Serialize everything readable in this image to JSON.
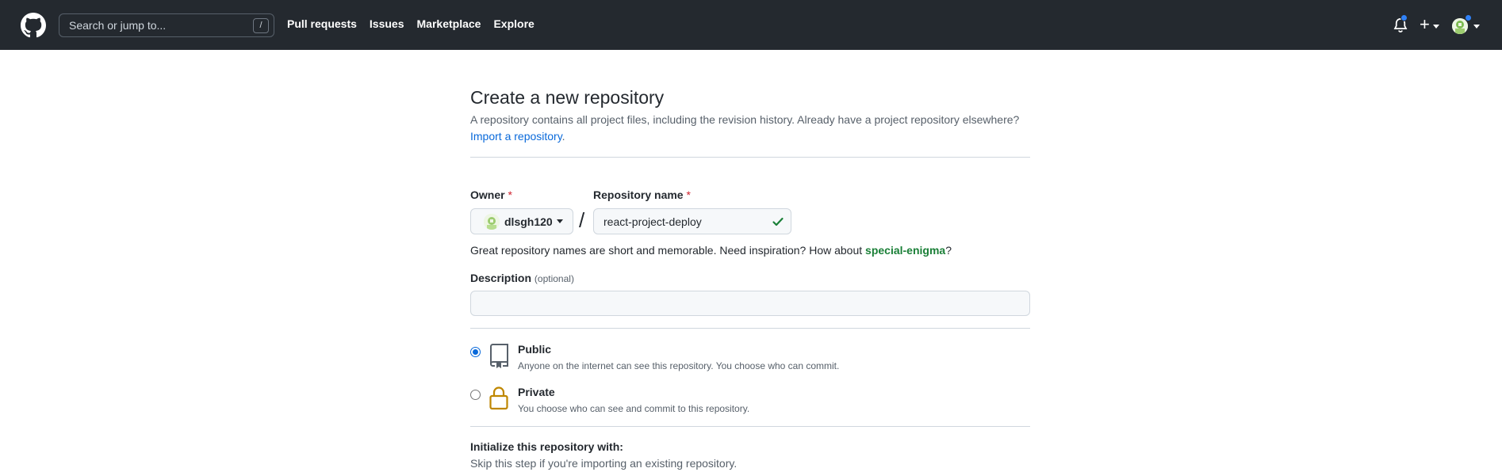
{
  "header": {
    "search_placeholder": "Search or jump to...",
    "search_shortcut": "/",
    "nav": [
      "Pull requests",
      "Issues",
      "Marketplace",
      "Explore"
    ],
    "plus": "+"
  },
  "page": {
    "title": "Create a new repository",
    "subtitle": "A repository contains all project files, including the revision history. Already have a project repository elsewhere?",
    "import_link": "Import a repository",
    "import_suffix": "."
  },
  "form": {
    "owner_label": "Owner",
    "owner_required": "*",
    "owner_value": "dlsgh120",
    "separator": "/",
    "repo_label": "Repository name",
    "repo_required": "*",
    "repo_value": "react-project-deploy",
    "hint_prefix": "Great repository names are short and memorable. Need inspiration? How about ",
    "hint_suggestion": "special-enigma",
    "hint_suffix": "?",
    "description_label": "Description",
    "description_optional": "(optional)",
    "description_value": ""
  },
  "visibility": {
    "public": {
      "title": "Public",
      "description": "Anyone on the internet can see this repository. You choose who can commit.",
      "checked": true
    },
    "private": {
      "title": "Private",
      "description": "You choose who can see and commit to this repository.",
      "checked": false
    }
  },
  "init": {
    "title": "Initialize this repository with:",
    "description": "Skip this step if you're importing an existing repository."
  },
  "colors": {
    "header_bg": "#24292f",
    "link": "#0969da",
    "success": "#1a7f37",
    "required": "#cf222e",
    "lock": "#bf8700"
  },
  "icons": [
    "github-logo-icon",
    "bell-icon",
    "plus-icon",
    "check-icon",
    "repo-icon",
    "lock-icon"
  ]
}
